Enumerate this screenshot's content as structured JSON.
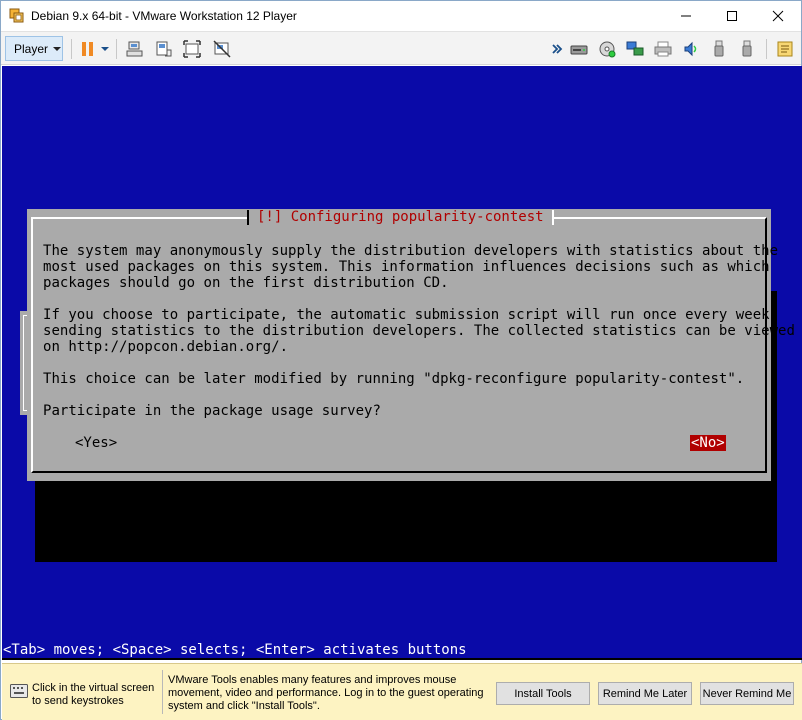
{
  "window": {
    "title": "Debian 9.x 64-bit - VMware Workstation 12 Player"
  },
  "toolbar": {
    "player_label": "Player",
    "left_icons": [
      "pause-icon",
      "dropdown-arrow-icon",
      "send-ctrl-alt-del-icon",
      "fit-guest-icon",
      "full-screen-icon",
      "unity-icon"
    ],
    "right_icons": [
      "expand-devices-icon",
      "hard-disk-icon",
      "cd-dvd-icon",
      "network-icon",
      "printer-icon",
      "sound-icon",
      "usb-icon",
      "usb-icon-2",
      "message-log-icon"
    ]
  },
  "console": {
    "dialog_title": "[!] Configuring popularity-contest",
    "paragraph_1": "The system may anonymously supply the distribution developers with statistics about the\nmost used packages on this system. This information influences decisions such as which\npackages should go on the first distribution CD.",
    "paragraph_2": "If you choose to participate, the automatic submission script will run once every week,\nsending statistics to the distribution developers. The collected statistics can be viewed\non http://popcon.debian.org/.",
    "paragraph_3": "This choice can be later modified by running \"dpkg-reconfigure popularity-contest\".",
    "question": "Participate in the package usage survey?",
    "yes_label": "<Yes>",
    "no_label": "<No>",
    "help_line": "<Tab> moves; <Space> selects; <Enter> activates buttons",
    "colors": {
      "background": "#0a0aa8",
      "dialog": "#aaaaaa",
      "title_text": "#b00000",
      "selected_button": "#b00000"
    }
  },
  "notification": {
    "keystroke_hint": "Click in the virtual screen to send keystrokes",
    "tools_message": "VMware Tools enables many features and improves mouse movement, video and performance. Log in to the guest operating system and click \"Install Tools\".",
    "install_label": "Install Tools",
    "remind_label": "Remind Me Later",
    "never_label": "Never Remind Me"
  }
}
